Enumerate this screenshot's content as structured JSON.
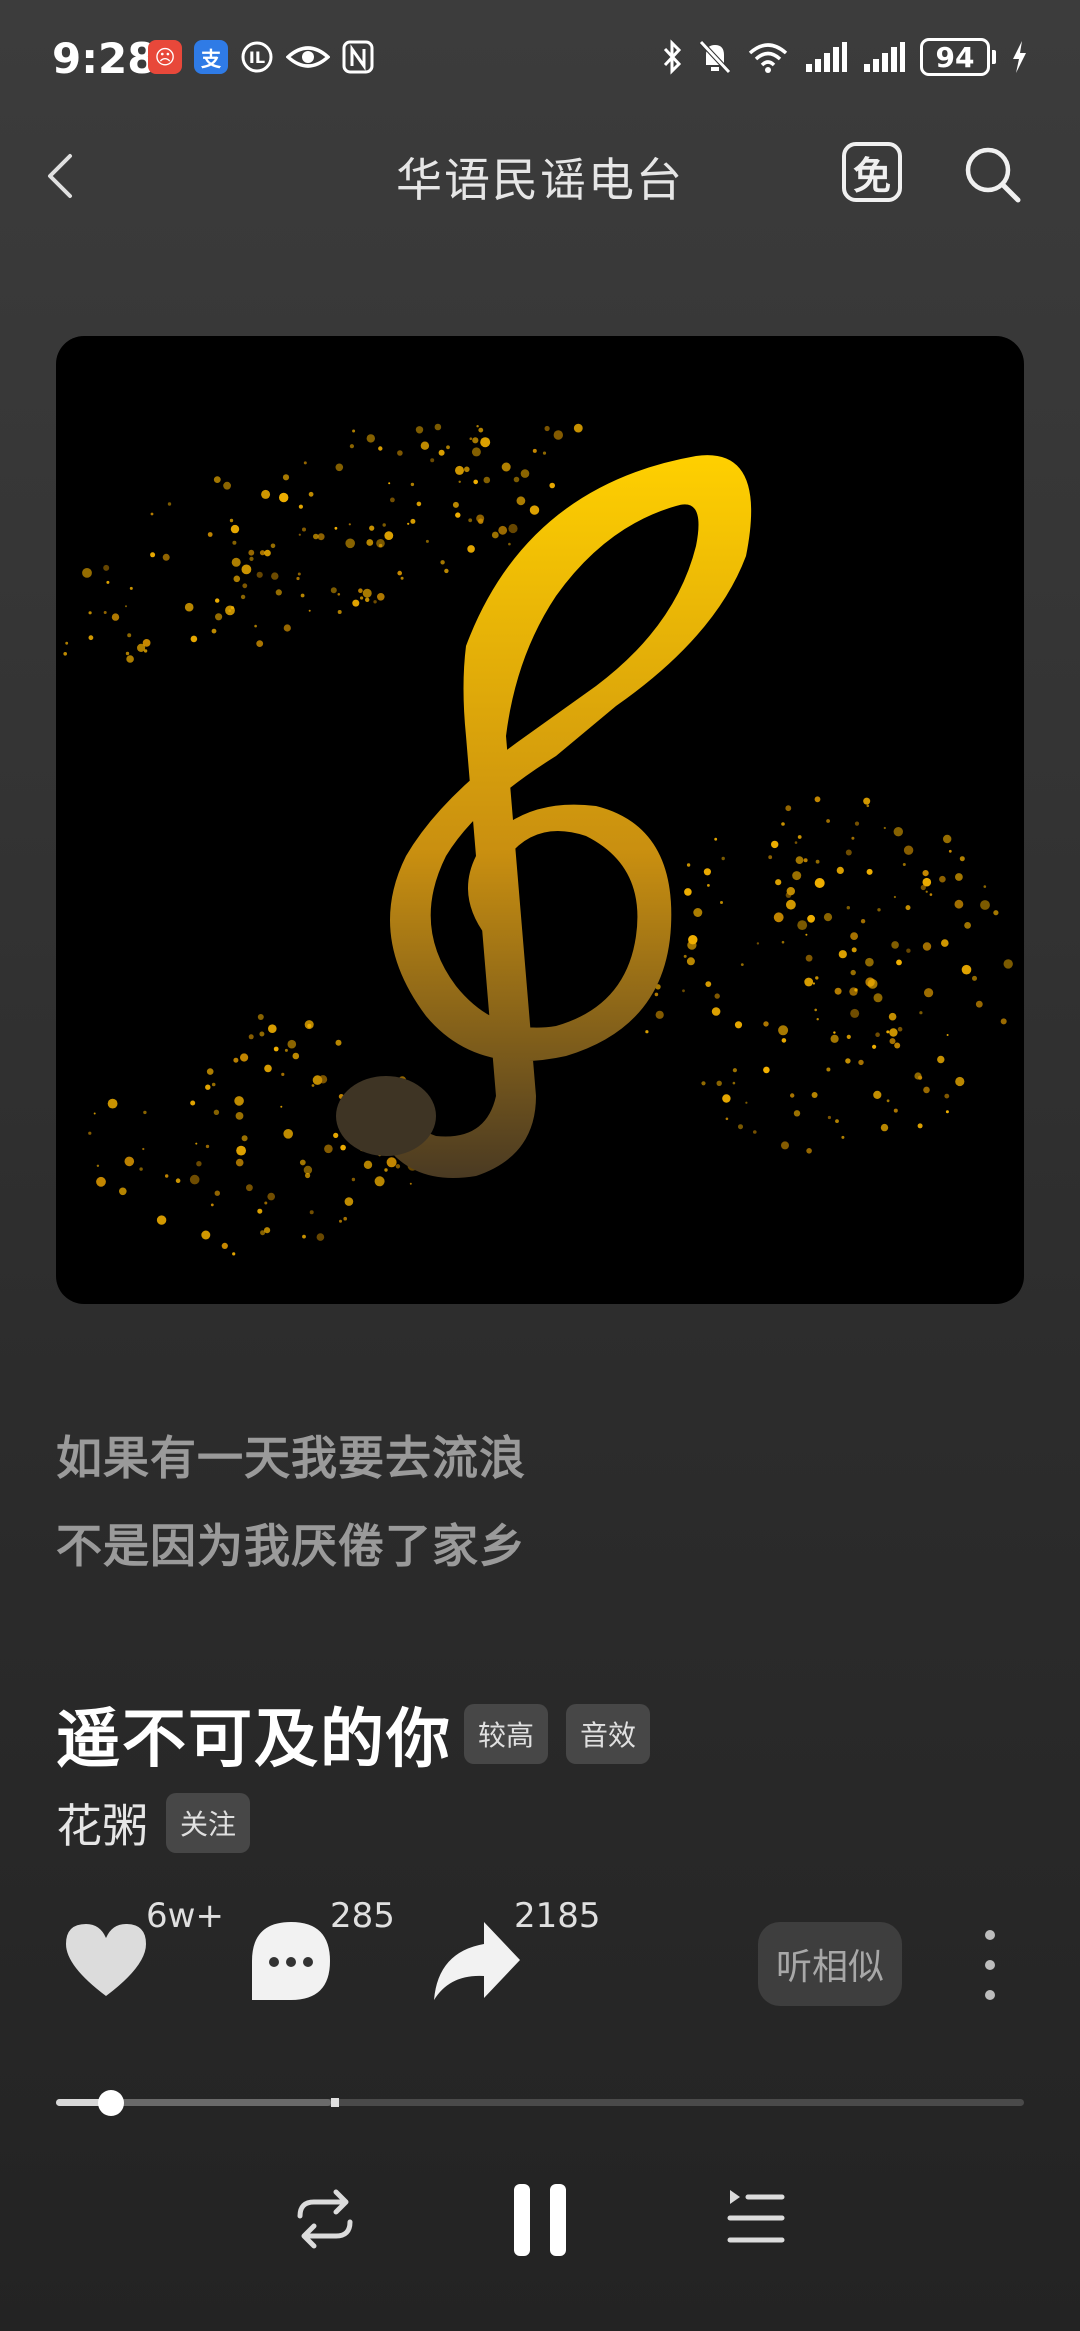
{
  "status_bar": {
    "time": "9:28",
    "battery": "94",
    "left_icons": [
      "app-red-icon",
      "alipay-icon",
      "badge-icon",
      "eye-icon",
      "nfc-icon"
    ],
    "right_icons": [
      "bluetooth-icon",
      "mute-icon",
      "wifi-icon",
      "signal-icon",
      "signal-icon",
      "battery-icon",
      "charging-icon"
    ]
  },
  "header": {
    "title": "华语民谣电台",
    "free_label": "免"
  },
  "lyrics": {
    "line1": "如果有一天我要去流浪",
    "line2": "不是因为我厌倦了家乡"
  },
  "song": {
    "title": "遥不可及的你",
    "quality_tag": "较高",
    "effect_tag": "音效",
    "artist": "花粥",
    "follow_label": "关注"
  },
  "actions": {
    "like_count": "6w+",
    "comment_count": "285",
    "share_count": "2185",
    "similar_label": "听相似"
  },
  "progress": {
    "played_fraction": 0.057,
    "buffered_fraction": 0.284
  },
  "colors": {
    "accent_gold": "#f2b800",
    "background": "#333333"
  }
}
